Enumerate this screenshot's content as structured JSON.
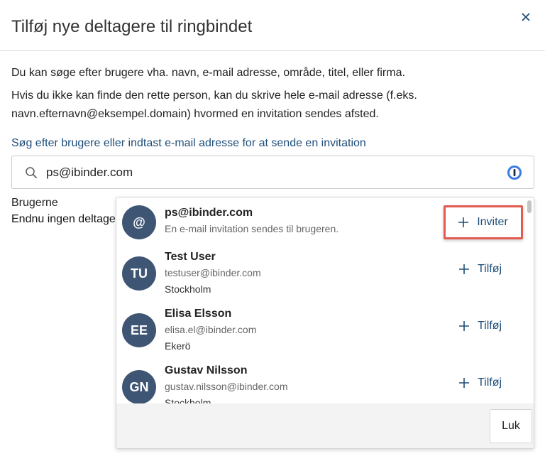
{
  "dialog": {
    "title": "Tilføj nye deltagere til ringbindet",
    "close_icon": "close-icon"
  },
  "intro": {
    "line1": "Du kan søge efter brugere vha. navn, e-mail adresse, område, titel, eller firma.",
    "line2": "Hvis du ikke kan finde den rette person, kan du skrive hele e-mail adresse (f.eks. navn.efternavn@eksempel.domain) hvormed en invitation sendes afsted."
  },
  "search": {
    "label": "Søg efter brugere eller indtast e-mail adresse for at sende en invitation",
    "value": "ps@ibinder.com",
    "icon": "search-icon",
    "password_manager_icon": "password-manager-icon"
  },
  "users": {
    "label": "Brugerne",
    "empty_text": "Endnu ingen deltagere"
  },
  "dropdown": {
    "invite": {
      "avatar": "@",
      "name": "ps@ibinder.com",
      "subtitle": "En e-mail invitation sendes til brugeren.",
      "button_label": "Inviter"
    },
    "results": [
      {
        "initials": "TU",
        "name": "Test User",
        "email": "testuser@ibinder.com",
        "location": "Stockholm",
        "button_label": "Tilføj"
      },
      {
        "initials": "EE",
        "name": "Elisa Elsson",
        "email": "elisa.el@ibinder.com",
        "location": "Ekerö",
        "button_label": "Tilføj"
      },
      {
        "initials": "GN",
        "name": "Gustav Nilsson",
        "email": "gustav.nilsson@ibinder.com",
        "location": "Stockholm",
        "button_label": "Tilføj"
      }
    ],
    "close_button_label": "Luk"
  },
  "colors": {
    "accent": "#1f4e79",
    "avatar": "#3e5574",
    "highlight": "#e35a4f"
  }
}
